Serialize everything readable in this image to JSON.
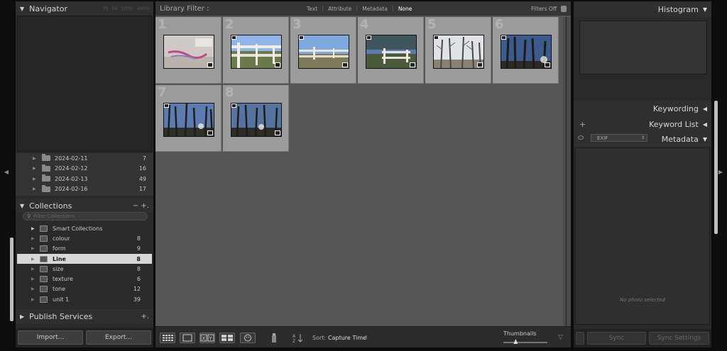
{
  "left_panel": {
    "navigator_title": "Navigator",
    "navigator_zoom": [
      "Fit",
      "Fill",
      "100%",
      "400%"
    ],
    "folders": [
      {
        "name": "2024-02-11",
        "count": "7"
      },
      {
        "name": "2024-02-12",
        "count": "16"
      },
      {
        "name": "2024-02-13",
        "count": "49"
      },
      {
        "name": "2024-02-16",
        "count": "17"
      }
    ],
    "collections_title": "Collections",
    "collections_controls": "−  +.",
    "collections_search_placeholder": "Filter Collections",
    "collections": [
      {
        "name": "Smart Collections",
        "count": ""
      },
      {
        "name": "colour",
        "count": "8"
      },
      {
        "name": "form",
        "count": "9"
      },
      {
        "name": "Line",
        "count": "8"
      },
      {
        "name": "size",
        "count": "8"
      },
      {
        "name": "texture",
        "count": "6"
      },
      {
        "name": "tone",
        "count": "12"
      },
      {
        "name": "unit 1",
        "count": "39"
      }
    ],
    "publish_title": "Publish Services",
    "publish_plus": "+.",
    "import_label": "Import...",
    "export_label": "Export..."
  },
  "center": {
    "filter_label": "Library Filter :",
    "filter_options": [
      "Text",
      "Attribute",
      "Metadata",
      "None"
    ],
    "filter_state": "Filters Off",
    "thumbnails": [
      {
        "num": "1"
      },
      {
        "num": "2"
      },
      {
        "num": "3"
      },
      {
        "num": "4"
      },
      {
        "num": "5"
      },
      {
        "num": "6"
      },
      {
        "num": "7"
      },
      {
        "num": "8"
      }
    ],
    "toolbar": {
      "sort_label": "Sort:",
      "sort_value": "Capture Time",
      "thumbnails_label": "Thumbnails",
      "thumbnail_size": 0.28
    }
  },
  "right_panel": {
    "histogram_title": "Histogram",
    "keywording_title": "Keywording",
    "keyword_list_title": "Keyword List",
    "metadata_title": "Metadata",
    "metadata_preset": "EXIF",
    "no_photo_text": "No photo selected",
    "sync_label": "Sync",
    "sync_settings_label": "Sync Settings"
  }
}
